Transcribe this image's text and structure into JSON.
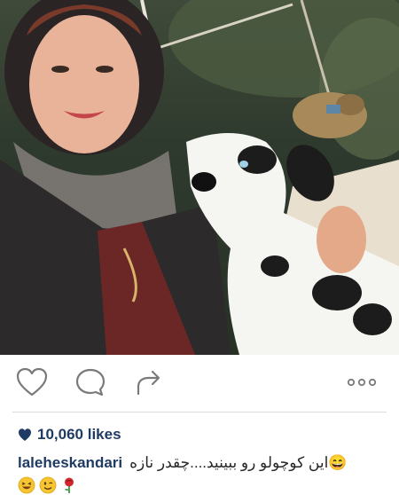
{
  "post": {
    "likes_count": "10,060 likes",
    "username": "laleheskandari",
    "caption_text": "😄این کوچولو رو ببینید....چقدر نازه",
    "caption_emojis": [
      "grinning-squint-emoji",
      "winking-emoji",
      "rose-emoji"
    ]
  },
  "actions": {
    "like_icon": "heart-outline-icon",
    "comment_icon": "comment-bubble-icon",
    "share_icon": "share-arrow-icon",
    "more_icon": "more-dots-icon"
  },
  "colors": {
    "username": "#1f3b63",
    "icon_stroke": "#7a7a7a",
    "divider": "#dbdbdb"
  }
}
